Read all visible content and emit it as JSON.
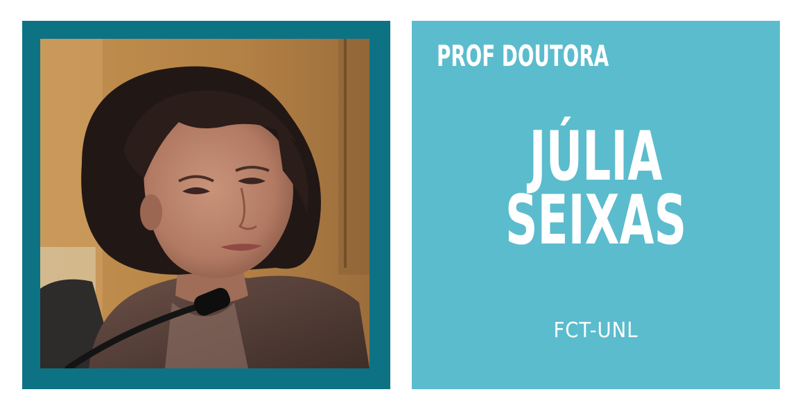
{
  "card": {
    "title": "PROF DOUTORA",
    "name_line_1": "JÚLIA",
    "name_line_2": "SEIXAS",
    "affiliation": "FCT-UNL"
  },
  "colors": {
    "frame": "#0d7384",
    "card_background": "#5bbccd",
    "text": "#ffffff",
    "page_background": "#ffffff"
  }
}
